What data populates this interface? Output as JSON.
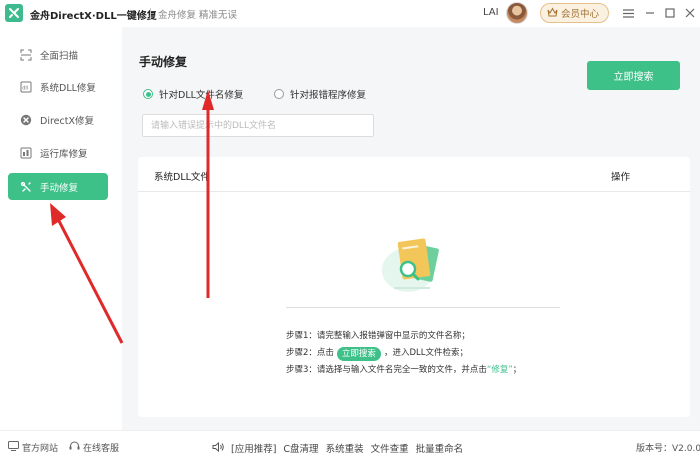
{
  "titlebar": {
    "app_title": "金舟DirectX·DLL一键修复",
    "slogan": "金舟修复 精准无误",
    "user_name": "LAI",
    "vip_label": "会员中心",
    "icons": [
      "logo-icon",
      "crown-icon",
      "menu-icon",
      "minimize-icon",
      "maximize-icon",
      "close-icon"
    ]
  },
  "sidebar": {
    "items": [
      {
        "label": "全面扫描",
        "icon": "scan-icon",
        "active": false
      },
      {
        "label": "系统DLL修复",
        "icon": "dll-icon",
        "active": false
      },
      {
        "label": "DirectX修复",
        "icon": "directx-icon",
        "active": false
      },
      {
        "label": "运行库修复",
        "icon": "runtime-icon",
        "active": false
      },
      {
        "label": "手动修复",
        "icon": "manual-repair-icon",
        "active": true
      }
    ]
  },
  "main": {
    "title": "手动修复",
    "search_button": "立即搜索",
    "radio_options": [
      {
        "label": "针对DLL文件名修复",
        "checked": true
      },
      {
        "label": "针对报错程序修复",
        "checked": false
      }
    ],
    "input_placeholder": "请输入错误提示中的DLL文件名",
    "table": {
      "columns": [
        "系统DLL文件",
        "操作"
      ]
    },
    "steps": {
      "step1": "步骤1：请完整输入报错弹窗中显示的文件名称；",
      "step2_prefix": "步骤2：点击",
      "step2_chip": "立即搜索",
      "step2_suffix": "，进入DLL文件检索；",
      "step3_prefix": "步骤3：请选择与输入文件名完全一致的文件，并点击",
      "step3_highlight": "“修复”",
      "step3_suffix": "；"
    }
  },
  "footer": {
    "official_site": "官方网站",
    "online_service": "在线客服",
    "app_recommend": "[应用推荐]",
    "links": [
      "C盘清理",
      "系统重装",
      "文件查重",
      "批量重命名"
    ],
    "version": "版本号：V2.0.0"
  },
  "colors": {
    "accent": "#3ec089",
    "vip": "#a27130",
    "annotation": "#e02a2a"
  }
}
